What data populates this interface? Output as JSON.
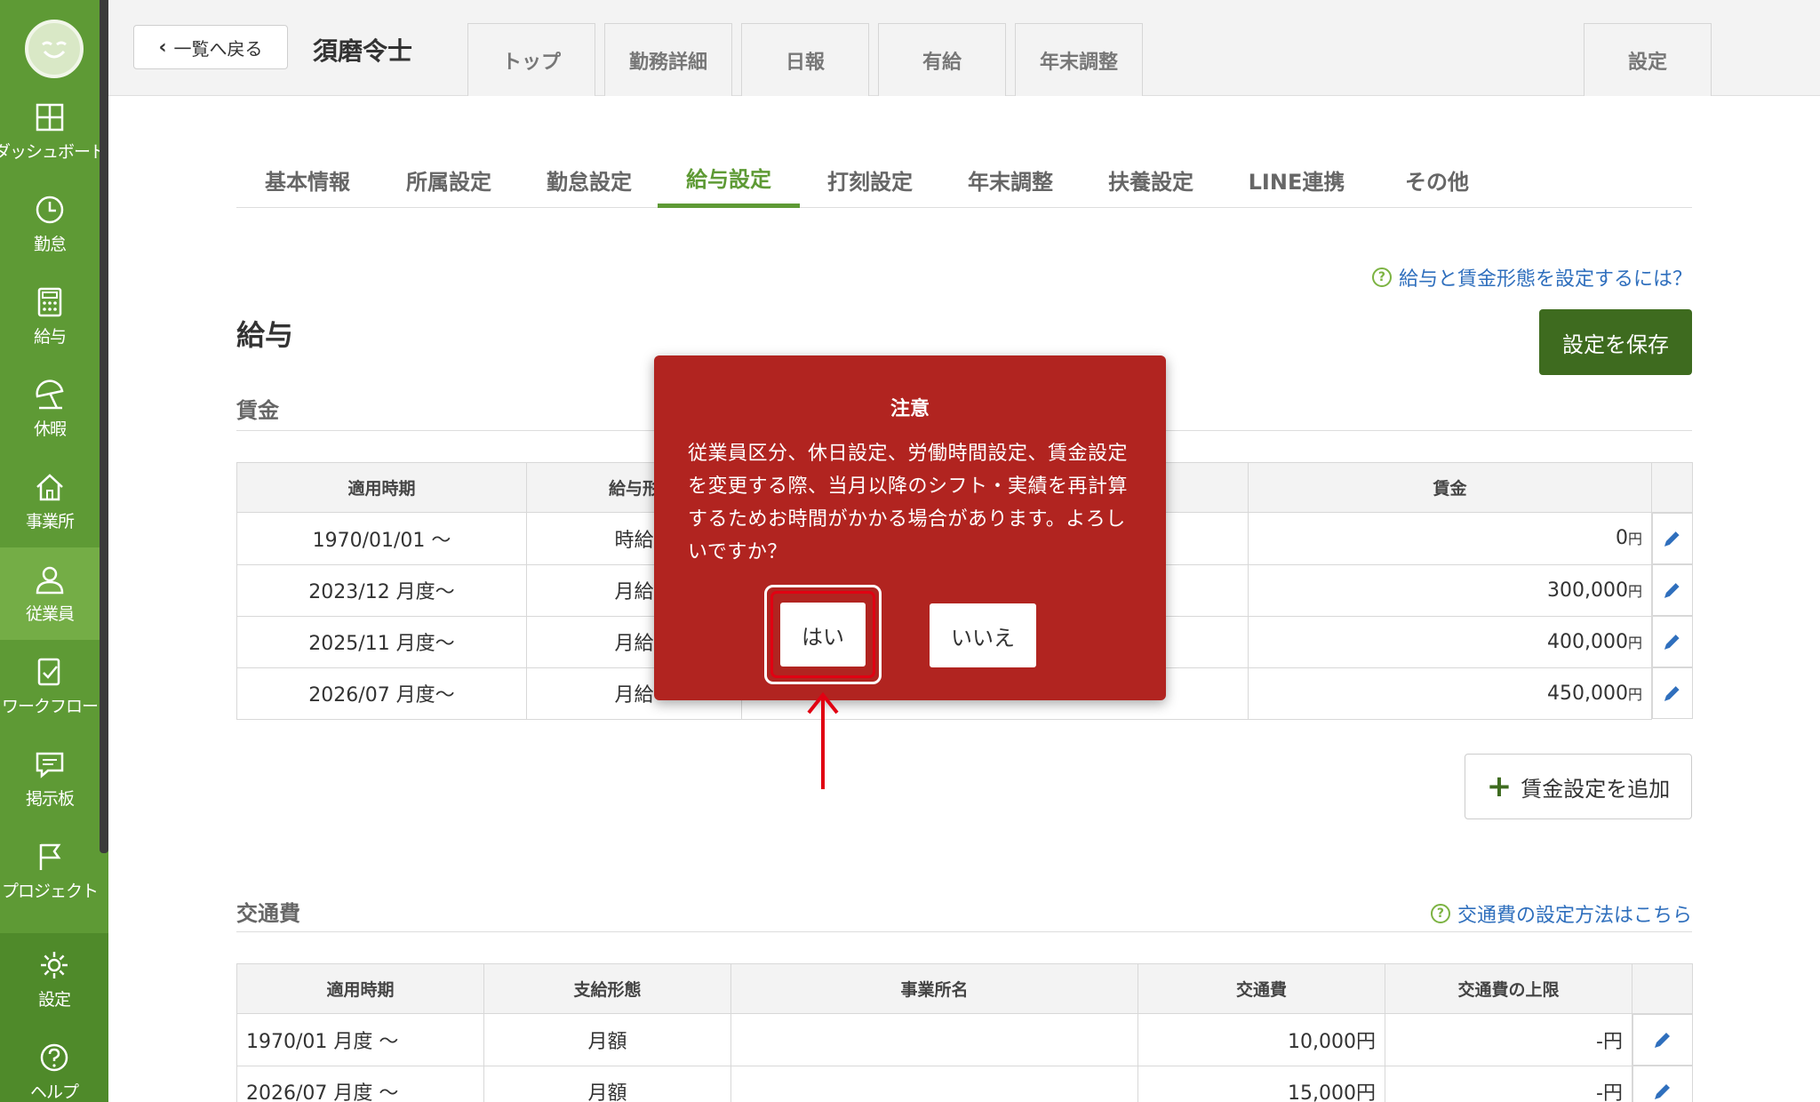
{
  "sidebar": {
    "items": [
      {
        "label": "ダッシュボード",
        "icon": "dashboard-icon"
      },
      {
        "label": "勤怠",
        "icon": "clock-icon"
      },
      {
        "label": "給与",
        "icon": "calculator-icon"
      },
      {
        "label": "休暇",
        "icon": "umbrella-icon"
      },
      {
        "label": "事業所",
        "icon": "home-icon"
      },
      {
        "label": "従業員",
        "icon": "person-icon",
        "active": true
      },
      {
        "label": "ワークフロー",
        "icon": "workflow-icon"
      },
      {
        "label": "掲示板",
        "icon": "message-board-icon"
      },
      {
        "label": "プロジェクト",
        "icon": "flag-icon"
      },
      {
        "label": "設定",
        "icon": "gear-icon"
      },
      {
        "label": "ヘルプ",
        "icon": "help-icon"
      }
    ]
  },
  "header": {
    "back_label": "一覧へ戻る",
    "employee_name": "須磨令士",
    "tabs": [
      "トップ",
      "勤務詳細",
      "日報",
      "有給",
      "年末調整"
    ],
    "settings_tab": "設定"
  },
  "subtabs": {
    "items": [
      "基本情報",
      "所属設定",
      "勤怠設定",
      "給与設定",
      "打刻設定",
      "年末調整",
      "扶養設定",
      "LINE連携",
      "その他"
    ],
    "active": "給与設定"
  },
  "help": {
    "salary": "給与と賃金形態を設定するには？",
    "transport": "交通費の設定方法はこちら"
  },
  "page": {
    "title": "給与",
    "save_label": "設定を保存",
    "wage_section": "賃金",
    "add_wage_label": "賃金設定を追加",
    "transport_section": "交通費"
  },
  "wage_table": {
    "headers": [
      "適用時期",
      "給与形",
      "",
      "賃金"
    ],
    "rows": [
      {
        "period": "1970/01/01 〜",
        "type": "時給",
        "wage": "0",
        "unit": "円"
      },
      {
        "period": "2023/12 月度〜",
        "type": "月給",
        "wage": "300,000",
        "unit": "円"
      },
      {
        "period": "2025/11 月度〜",
        "type": "月給",
        "wage": "400,000",
        "unit": "円"
      },
      {
        "period": "2026/07 月度〜",
        "type": "月給",
        "wage": "450,000",
        "unit": "円"
      }
    ]
  },
  "transport_table": {
    "headers": [
      "適用時期",
      "支給形態",
      "事業所名",
      "交通費",
      "交通費の上限"
    ],
    "rows": [
      {
        "period": "1970/01 月度 〜",
        "type": "月額",
        "office": "",
        "amount": "10,000円",
        "limit": "-円"
      },
      {
        "period": "2026/07 月度 〜",
        "type": "月額",
        "office": "",
        "amount": "15,000円",
        "limit": "-円"
      }
    ]
  },
  "modal": {
    "title": "注意",
    "message": "従業員区分、休日設定、労働時間設定、賃金設定を変更する際、当月以降のシフト・実績を再計算するためお時間がかかる場合があります。よろしいですか？",
    "yes_label": "はい",
    "no_label": "いいえ"
  },
  "colors": {
    "sidebar": "#5e9a35",
    "accent": "#5e9a35",
    "save_button": "#3e6b1f",
    "modal": "#b12420",
    "highlight": "#e10012",
    "link": "#2f6fbd"
  }
}
